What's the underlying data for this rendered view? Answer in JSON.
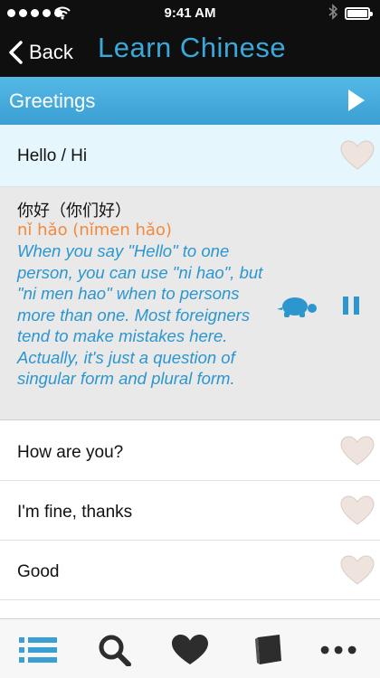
{
  "status_bar": {
    "time": "9:41 AM"
  },
  "nav": {
    "back_label": "Back",
    "title": "Learn Chinese"
  },
  "category": {
    "label": "Greetings"
  },
  "phrases": [
    {
      "label": "Hello / Hi"
    },
    {
      "label": "How are you?"
    },
    {
      "label": "I'm fine, thanks"
    },
    {
      "label": "Good"
    }
  ],
  "detail": {
    "chinese": "你好（你们好）",
    "pinyin": "nǐ hǎo (nǐmen hǎo)",
    "explanation": "When you say \"Hello\" to one person, you can use \"ni hao\", but \"ni men hao\" when to persons more than one. Most foreigners tend to make mistakes here. Actually, it's just a question of singular form and plural form."
  },
  "colors": {
    "accent": "#3aa9d9",
    "pinyin": "#f28a3c",
    "explanation": "#2c96cf",
    "selected_row": "#e6f6fd",
    "heart": "#efe3dd",
    "tab_active": "#3a9fd2"
  },
  "icons": {
    "tabs": [
      "list-icon",
      "search-icon",
      "heart-icon",
      "book-icon",
      "more-icon"
    ],
    "controls": [
      "play-icon",
      "turtle-icon",
      "pause-icon"
    ]
  }
}
